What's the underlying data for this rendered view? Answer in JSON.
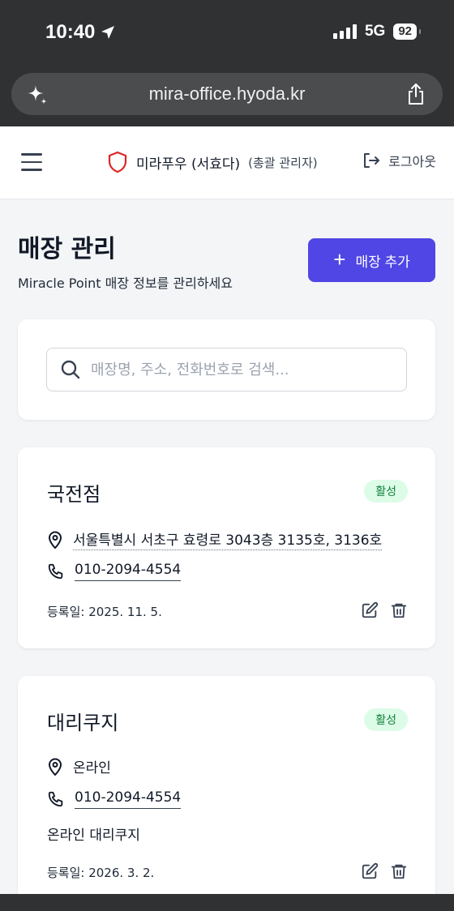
{
  "status_bar": {
    "time": "10:40",
    "network": "5G",
    "battery": "92"
  },
  "browser": {
    "url": "mira-office.hyoda.kr"
  },
  "header": {
    "user_name": "미라푸우 (서효다)",
    "user_role": "(총괄 관리자)",
    "logout_label": "로그아웃"
  },
  "page": {
    "title": "매장 관리",
    "subtitle": "Miracle Point 매장 정보를 관리하세요",
    "add_button_label": "매장 추가"
  },
  "search": {
    "placeholder": "매장명, 주소, 전화번호로 검색..."
  },
  "stores": [
    {
      "name": "국전점",
      "status": "활성",
      "address": "서울특별시 서초구 효령로 3043층 3135호, 3136호",
      "phone": "010-2094-4554",
      "memo": "",
      "registered": "등록일: 2025. 11. 5."
    },
    {
      "name": "대리쿠지",
      "status": "활성",
      "address": "온라인",
      "phone": "010-2094-4554",
      "memo": "온라인 대리쿠지",
      "registered": "등록일: 2026. 3. 2."
    }
  ],
  "colors": {
    "primary": "#4f46e5",
    "badge_bg": "#dcfce7",
    "badge_text": "#15803d",
    "shield": "#dc2626"
  }
}
